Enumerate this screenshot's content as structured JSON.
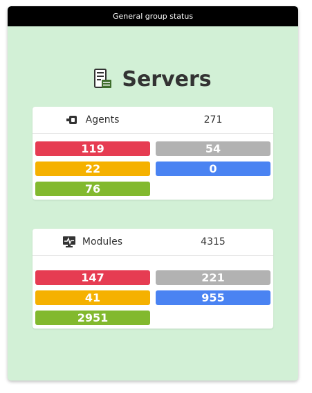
{
  "widget": {
    "header_title": "General group status",
    "title": "Servers",
    "title_icon": "server-icon",
    "background_color": "#d2f0d6"
  },
  "agents": {
    "label": "Agents",
    "icon": "agents-icon",
    "total": "271",
    "critical": "119",
    "unknown": "54",
    "warning": "22",
    "not_init": "0",
    "normal": "76"
  },
  "modules": {
    "label": "Modules",
    "icon": "monitor-icon",
    "total": "4315",
    "critical": "147",
    "unknown": "221",
    "warning": "41",
    "not_init": "955",
    "normal": "2951"
  },
  "status_colors": {
    "critical": "#e63c52",
    "unknown": "#b2b2b2",
    "warning": "#f5b100",
    "not_init": "#4a83f2",
    "normal": "#82b92e"
  }
}
